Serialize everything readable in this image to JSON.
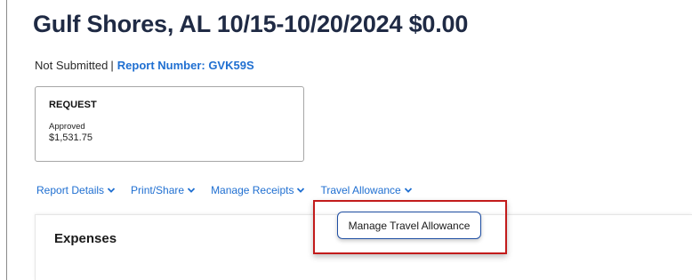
{
  "report": {
    "title": "Gulf Shores, AL 10/15-10/20/2024 $0.00",
    "status": "Not Submitted",
    "separator": "|",
    "report_number": "Report Number: GVK59S"
  },
  "request_card": {
    "title": "REQUEST",
    "status": "Approved",
    "amount": "$1,531.75"
  },
  "nav": {
    "items": [
      {
        "label": "Report Details",
        "icon": "chevron-down-icon"
      },
      {
        "label": "Print/Share",
        "icon": "chevron-down-icon"
      },
      {
        "label": "Manage Receipts",
        "icon": "chevron-down-icon"
      },
      {
        "label": "Travel Allowance",
        "icon": "chevron-down-icon"
      }
    ]
  },
  "dropdown": {
    "items": [
      {
        "label": "Manage Travel Allowance"
      }
    ]
  },
  "expenses": {
    "title": "Expenses"
  },
  "colors": {
    "link": "#1f6fd1",
    "title": "#1f2a44",
    "highlight": "#c21b1b",
    "dropdown_border": "#1f4fa3"
  }
}
